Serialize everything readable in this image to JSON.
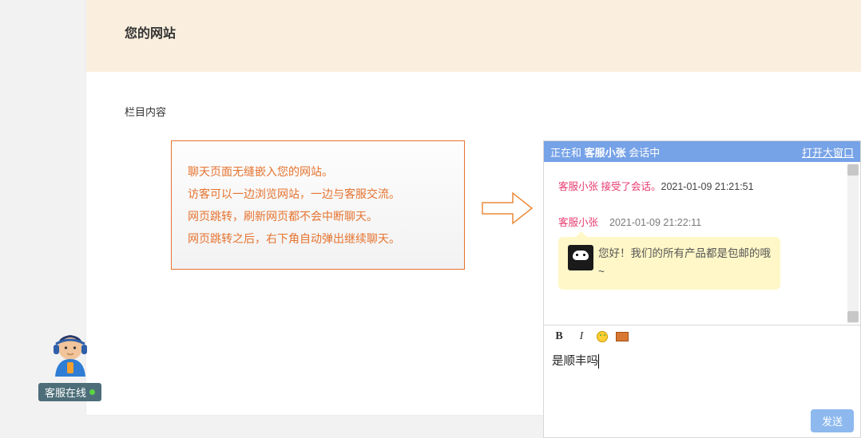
{
  "page": {
    "title": "您的网站",
    "section_label": "栏目内容"
  },
  "info_lines": [
    "聊天页面无缝嵌入您的网站。",
    "访客可以一边浏览网站，一边与客服交流。",
    "网页跳转，刷新网页都不会中断聊天。",
    "网页跳转之后，右下角自动弹出继续聊天。"
  ],
  "chat": {
    "title_prefix": "正在和 ",
    "title_agent": "客服小张",
    "title_suffix": " 会话中",
    "open_big": "打开大窗口",
    "system": {
      "agent": "客服小张",
      "accepted": " 接受了会话。",
      "time": "2021-01-09 21:21:51"
    },
    "msg1": {
      "agent": "客服小张",
      "time": "2021-01-09 21:22:11",
      "text": "您好！我们的所有产品都是包邮的哦~"
    },
    "compose_text": "是顺丰吗",
    "send_label": "发送"
  },
  "float": {
    "label": "客服在线"
  }
}
